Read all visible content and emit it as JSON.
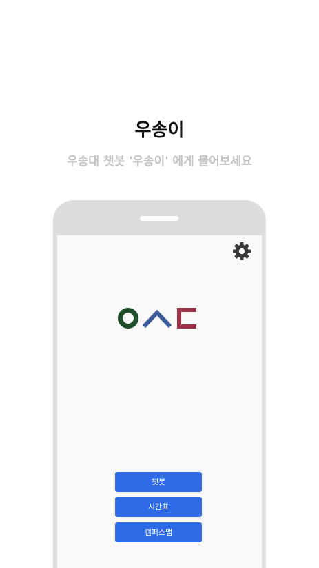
{
  "header": {
    "title": "우송이",
    "subtitle": "우송대 챗봇 '우송이' 에게 물어보세요"
  },
  "app": {
    "settings_icon": "gear-icon",
    "logo_colors": {
      "circle": "#1f4d2a",
      "chevron": "#3c5a9a",
      "bracket": "#9c3247"
    },
    "buttons": [
      {
        "label": "챗봇"
      },
      {
        "label": "시간표"
      },
      {
        "label": "캠퍼스맵"
      }
    ]
  },
  "colors": {
    "accent": "#2f6be6",
    "phone_frame": "#dddddd",
    "screen_bg": "#f9f9f9",
    "subtitle": "#c4c4c4"
  }
}
